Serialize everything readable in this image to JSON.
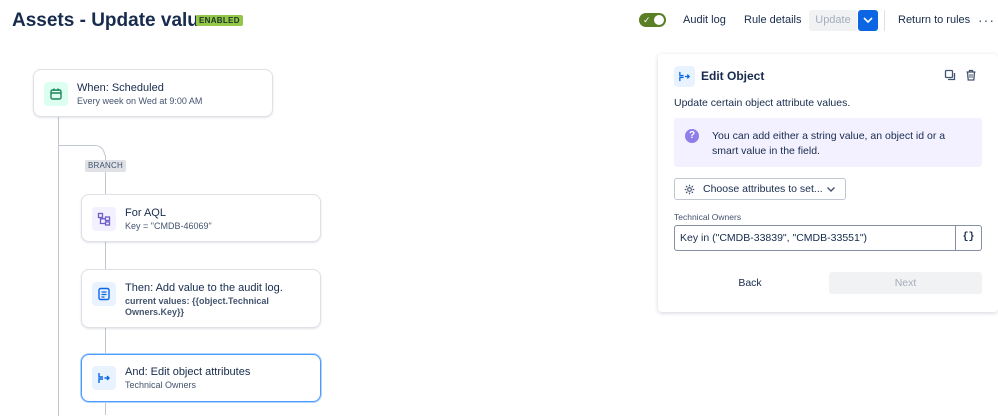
{
  "header": {
    "title": "Assets - Update values",
    "status": "ENABLED",
    "audit_log": "Audit log",
    "rule_details": "Rule details",
    "update": "Update",
    "return_to_rules": "Return to rules",
    "more": "···"
  },
  "canvas": {
    "trigger": {
      "title": "When: Scheduled",
      "subtitle": "Every week on Wed at 9:00 AM"
    },
    "branch_label": "BRANCH",
    "for_aql": {
      "title": "For AQL",
      "subtitle": "Key = \"CMDB-46069\""
    },
    "audit_action": {
      "title": "Then: Add value to the audit log.",
      "subtitle": "current values: {{object.Technical Owners.Key}}"
    },
    "edit_action": {
      "title": "And: Edit object attributes",
      "subtitle": "Technical Owners"
    }
  },
  "panel": {
    "title": "Edit Object",
    "description": "Update certain object attribute values.",
    "info": "You can add either a string value, an object id or a smart value in the field.",
    "choose_attributes": "Choose attributes to set...",
    "field_label": "Technical Owners",
    "field_value": "Key in (\"CMDB-33839\", \"CMDB-33551\")",
    "smart_value": "{}",
    "back": "Back",
    "next": "Next"
  },
  "colors": {
    "accent": "#0c66e4",
    "toggle": "#5b7f24",
    "enabled_lozenge": "#94c748",
    "info_background": "#f3f0ff"
  }
}
